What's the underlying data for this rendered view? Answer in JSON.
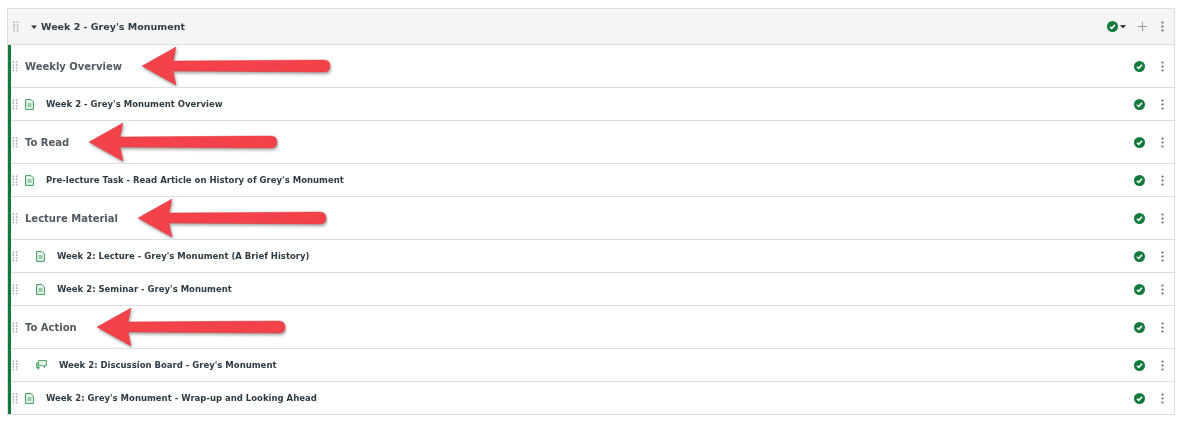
{
  "module": {
    "title": "Week 2 - Grey's Monument",
    "expanded": true,
    "published": true
  },
  "items": [
    {
      "kind": "header",
      "title": "Weekly Overview",
      "published": true,
      "annotated": true,
      "indented": false
    },
    {
      "kind": "page",
      "title": "Week 2 - Grey's Monument Overview",
      "published": true,
      "annotated": false,
      "indented": false
    },
    {
      "kind": "header",
      "title": "To Read",
      "published": true,
      "annotated": true,
      "indented": false
    },
    {
      "kind": "page",
      "title": "Pre-lecture Task - Read Article on History of Grey's Monument",
      "published": true,
      "annotated": false,
      "indented": false
    },
    {
      "kind": "header",
      "title": "Lecture Material",
      "published": true,
      "annotated": true,
      "indented": false
    },
    {
      "kind": "page",
      "title": "Week 2: Lecture - Grey's Monument (A Brief History)",
      "published": true,
      "annotated": false,
      "indented": true
    },
    {
      "kind": "page",
      "title": "Week 2: Seminar - Grey's Monument",
      "published": true,
      "annotated": false,
      "indented": true
    },
    {
      "kind": "header",
      "title": "To Action",
      "published": true,
      "annotated": true,
      "indented": false
    },
    {
      "kind": "discussion",
      "title": "Week 2: Discussion Board - Grey's Monument",
      "published": true,
      "annotated": false,
      "indented": true
    },
    {
      "kind": "page",
      "title": "Week 2: Grey's Monument - Wrap-up and Looking Ahead",
      "published": true,
      "annotated": false,
      "indented": false
    }
  ]
}
